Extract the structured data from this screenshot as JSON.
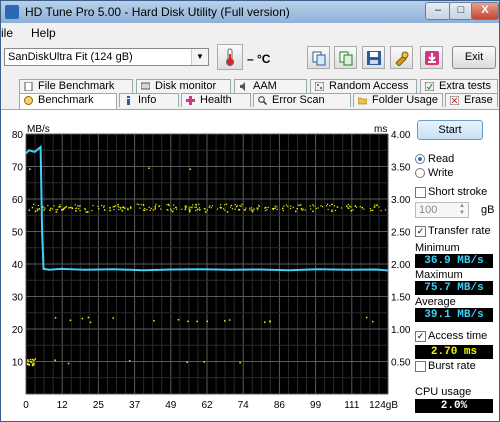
{
  "window": {
    "title": "HD Tune Pro 5.00 - Hard Disk Utility (Full version)",
    "min": "–",
    "max": "□",
    "close": "X"
  },
  "menu": {
    "file": "ile",
    "help": "Help"
  },
  "toolbar": {
    "drive": "SanDiskUltra Fit (124 gB)",
    "temperature": "– °C",
    "exit": "Exit"
  },
  "tabs": {
    "row1": [
      "File Benchmark",
      "Disk monitor",
      "AAM",
      "Random Access",
      "Extra tests"
    ],
    "row2": [
      "Benchmark",
      "Info",
      "Health",
      "Error Scan",
      "Folder Usage",
      "Erase"
    ]
  },
  "chart_data": {
    "type": "line",
    "y_left_unit": "MB/s",
    "y_right_unit": "ms",
    "y_left_ticks": [
      "80",
      "70",
      "60",
      "50",
      "40",
      "30",
      "20",
      "10"
    ],
    "y_right_ticks": [
      "4.00",
      "3.50",
      "3.00",
      "2.50",
      "2.00",
      "1.50",
      "1.00",
      "0.50"
    ],
    "x_ticks": [
      "0",
      "12",
      "25",
      "37",
      "49",
      "62",
      "74",
      "86",
      "99",
      "111",
      "124gB"
    ],
    "ylim_left": [
      0,
      80
    ],
    "ylim_right": [
      0,
      4
    ],
    "xlim": [
      0,
      124
    ],
    "transfer_rate_series": {
      "name": "Transfer rate",
      "color": "#3fd0f5",
      "x": [
        0,
        1,
        3,
        5,
        5.5,
        6,
        8,
        12,
        20,
        30,
        40,
        50,
        60,
        70,
        80,
        90,
        100,
        110,
        120,
        124
      ],
      "y": [
        74,
        75,
        74.5,
        76,
        50,
        38.5,
        38.2,
        38.5,
        38.2,
        38.4,
        38.1,
        38.3,
        38.4,
        38.2,
        38.3,
        38.1,
        38.4,
        38.2,
        38.3,
        38
      ]
    },
    "access_time_color": "#f2f200",
    "access_time_bands_ms": [
      0.5,
      1.15,
      2.85,
      3.45
    ],
    "grid": true
  },
  "panel": {
    "start": "Start",
    "read": "Read",
    "write": "Write",
    "short_stroke": "Short stroke",
    "stroke_value": "100",
    "stroke_unit": "gB",
    "transfer_rate": "Transfer rate",
    "minimum_label": "Minimum",
    "minimum_value": "36.9 MB/s",
    "maximum_label": "Maximum",
    "maximum_value": "75.7 MB/s",
    "average_label": "Average",
    "average_value": "39.1 MB/s",
    "access_time": "Access time",
    "access_value": "2.70 ms",
    "burst_rate": "Burst rate",
    "cpu_label": "CPU usage",
    "cpu_value": "2.0%"
  }
}
